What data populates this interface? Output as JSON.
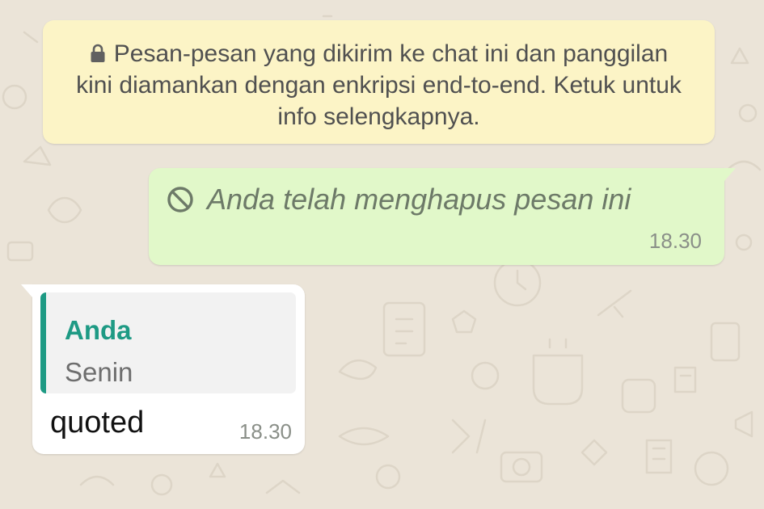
{
  "colors": {
    "background": "#ebe4d8",
    "notice_background": "#fcf4c6",
    "outgoing_bubble": "#e1f8c9",
    "incoming_bubble": "#ffffff",
    "quote_accent": "#1e9a84"
  },
  "encryption_notice": {
    "icon": "lock-icon",
    "text": "Pesan-pesan yang dikirim ke chat ini dan panggilan kini diamankan dengan enkripsi end-to-end. Ketuk untuk info selengkapnya."
  },
  "messages": [
    {
      "direction": "outgoing",
      "icon": "ban-icon",
      "text": "Anda telah menghapus pesan ini",
      "time": "18.30"
    },
    {
      "direction": "incoming",
      "quote": {
        "author": "Anda",
        "text": "Senin"
      },
      "text": "quoted",
      "time": "18.30"
    }
  ]
}
